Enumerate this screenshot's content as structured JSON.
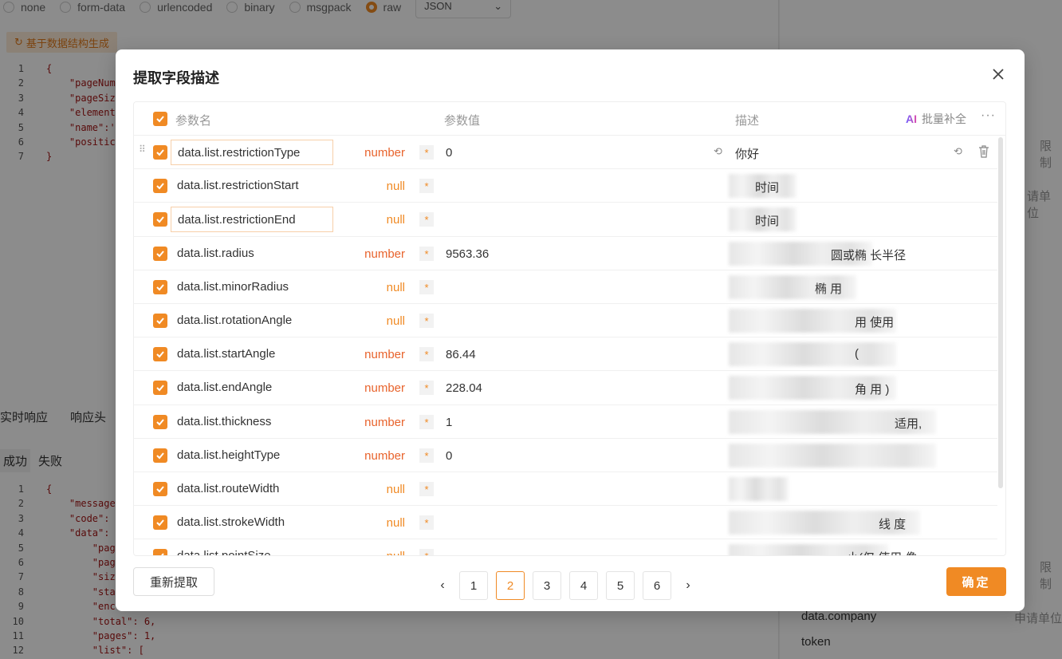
{
  "background": {
    "body_types": [
      "none",
      "form-data",
      "urlencoded",
      "binary",
      "msgpack",
      "raw"
    ],
    "body_type_selected": "raw",
    "raw_format": "JSON",
    "generate_button": "基于数据结构生成",
    "request_code": [
      {
        "ln": "1",
        "text": "{"
      },
      {
        "ln": "2",
        "text": "    \"pageNum"
      },
      {
        "ln": "3",
        "text": "    \"pageSiz"
      },
      {
        "ln": "4",
        "text": "    \"element"
      },
      {
        "ln": "5",
        "text": "    \"name\":'"
      },
      {
        "ln": "6",
        "text": "    \"positic"
      },
      {
        "ln": "7",
        "text": "}"
      }
    ],
    "response_tabs": [
      "实时响应",
      "响应头"
    ],
    "response_filters": [
      "成功",
      "失败"
    ],
    "response_code": [
      {
        "ln": "1",
        "text": "{"
      },
      {
        "ln": "2",
        "text": "    \"message"
      },
      {
        "ln": "3",
        "text": "    \"code\":"
      },
      {
        "ln": "4",
        "text": "    \"data\":"
      },
      {
        "ln": "5",
        "text": "        \"pag"
      },
      {
        "ln": "6",
        "text": "        \"pag"
      },
      {
        "ln": "7",
        "text": "        \"siz"
      },
      {
        "ln": "8",
        "text": "        \"sta"
      },
      {
        "ln": "9",
        "text": "        \"enc"
      },
      {
        "ln": "10",
        "text": "        \"total\": 6,"
      },
      {
        "ln": "11",
        "text": "        \"pages\": 1,"
      },
      {
        "ln": "12",
        "text": "        \"list\": ["
      }
    ],
    "right_panel": {
      "limit_1": "限制",
      "unit_1": "请单位",
      "limit_2": "限制",
      "field_company": "data.company",
      "unit_2": "申请单位",
      "field_token": "token"
    }
  },
  "modal": {
    "title": "提取字段描述",
    "columns": {
      "name": "参数名",
      "value": "参数值",
      "description": "描述"
    },
    "ai_label": "AI",
    "batch_fill": "批量补全",
    "more": "···",
    "rows": [
      {
        "name": "data.list.restrictionType",
        "type": "number",
        "required": "*",
        "value": "0",
        "description": "你好"
      },
      {
        "name": "data.list.restrictionStart",
        "type": "null",
        "required": "*",
        "value": "",
        "description": "时间"
      },
      {
        "name": "data.list.restrictionEnd",
        "type": "null",
        "required": "*",
        "value": "",
        "description": "时间"
      },
      {
        "name": "data.list.radius",
        "type": "number",
        "required": "*",
        "value": "9563.36",
        "description": "圆或椭 长半径"
      },
      {
        "name": "data.list.minorRadius",
        "type": "null",
        "required": "*",
        "value": "",
        "description": "椭 用"
      },
      {
        "name": "data.list.rotationAngle",
        "type": "null",
        "required": "*",
        "value": "",
        "description": "用 使用"
      },
      {
        "name": "data.list.startAngle",
        "type": "number",
        "required": "*",
        "value": "86.44",
        "description": "("
      },
      {
        "name": "data.list.endAngle",
        "type": "number",
        "required": "*",
        "value": "228.04",
        "description": "角 用 )"
      },
      {
        "name": "data.list.thickness",
        "type": "number",
        "required": "*",
        "value": "1",
        "description": "适用,"
      },
      {
        "name": "data.list.heightType",
        "type": "number",
        "required": "*",
        "value": "0",
        "description": ""
      },
      {
        "name": "data.list.routeWidth",
        "type": "null",
        "required": "*",
        "value": "",
        "description": ""
      },
      {
        "name": "data.list.strokeWidth",
        "type": "null",
        "required": "*",
        "value": "",
        "description": "线 度"
      },
      {
        "name": "data.list.pointSize",
        "type": "null",
        "required": "*",
        "value": "",
        "description": "小(仅 使用 像"
      }
    ],
    "reextract_button": "重新提取",
    "pagination": {
      "prev": "‹",
      "next": "›",
      "pages": [
        "1",
        "2",
        "3",
        "4",
        "5",
        "6"
      ],
      "current": "2"
    },
    "confirm_button": "确定"
  },
  "colors": {
    "accent": "#f08a24",
    "number_type": "#e8632c",
    "null_type": "#f08a24"
  }
}
